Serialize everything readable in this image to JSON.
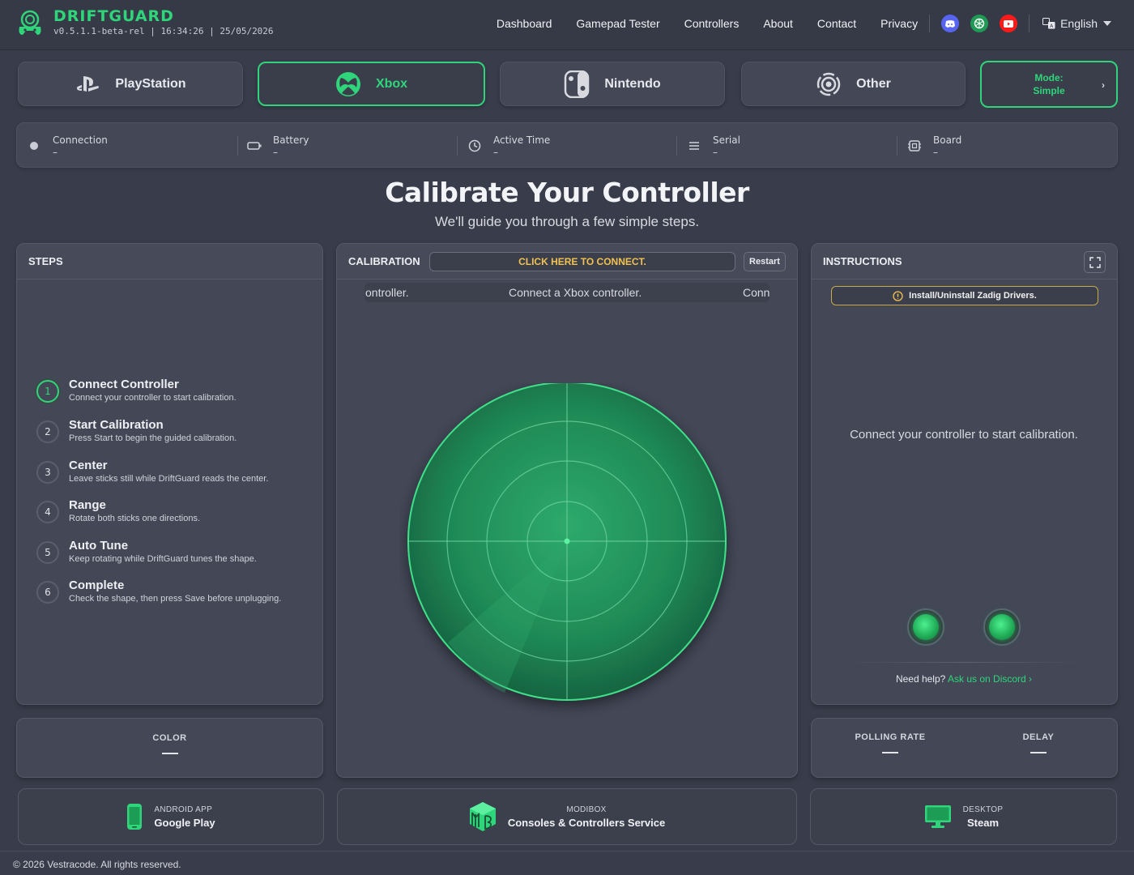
{
  "brand": {
    "name": "DRIFTGUARD",
    "version": "v0.5.1.1-beta-rel",
    "time": "16:34:26",
    "date": "25/05/2026",
    "sep": "|"
  },
  "nav": {
    "items": [
      "Dashboard",
      "Gamepad Tester",
      "Controllers",
      "About",
      "Contact",
      "Privacy"
    ],
    "language": "English",
    "social": [
      "discord-icon",
      "openai-icon",
      "youtube-icon"
    ]
  },
  "platforms": [
    {
      "label": "PlayStation",
      "active": false
    },
    {
      "label": "Xbox",
      "active": true
    },
    {
      "label": "Nintendo",
      "active": false
    },
    {
      "label": "Other",
      "active": false
    }
  ],
  "mode": {
    "label": "Mode:",
    "value": "Simple"
  },
  "status": [
    {
      "label": "Connection",
      "value": "–"
    },
    {
      "label": "Battery",
      "value": "–"
    },
    {
      "label": "Active Time",
      "value": "–"
    },
    {
      "label": "Serial",
      "value": "–"
    },
    {
      "label": "Board",
      "value": "–"
    }
  ],
  "hero": {
    "title": "Calibrate Your Controller",
    "subtitle": "We'll guide you through a few simple steps."
  },
  "steps": {
    "header": "STEPS",
    "items": [
      {
        "num": "1",
        "title": "Connect Controller",
        "desc": "Connect your controller to start calibration.",
        "active": true
      },
      {
        "num": "2",
        "title": "Start Calibration",
        "desc": "Press Start to begin the guided calibration."
      },
      {
        "num": "3",
        "title": "Center",
        "desc": "Leave sticks still while DriftGuard reads the center."
      },
      {
        "num": "4",
        "title": "Range",
        "desc": "Rotate both sticks one directions."
      },
      {
        "num": "5",
        "title": "Auto Tune",
        "desc": "Keep rotating while DriftGuard tunes the shape."
      },
      {
        "num": "6",
        "title": "Complete",
        "desc": "Check the shape, then press Save before unplugging."
      }
    ]
  },
  "calibration": {
    "header": "CALIBRATION",
    "connect": "CLICK HERE TO CONNECT.",
    "restart": "Restart",
    "ticker": [
      "ontroller.",
      "Connect a Xbox controller.",
      "Conn"
    ]
  },
  "instructions": {
    "header": "INSTRUCTIONS",
    "zadig": "Install/Uninstall Zadig Drivers.",
    "message": "Connect your controller to start calibration.",
    "help_prefix": "Need help?",
    "help_link": "Ask us on Discord ›"
  },
  "color": {
    "label": "COLOR"
  },
  "metrics": {
    "polling": "POLLING RATE",
    "delay": "DELAY"
  },
  "footer_cards": [
    {
      "small": "ANDROID APP",
      "big": "Google Play"
    },
    {
      "small": "MODIBOX",
      "big": "Consoles & Controllers Service"
    },
    {
      "small": "DESKTOP",
      "big": "Steam"
    }
  ],
  "copyright": "© 2026 Vestracode. All rights reserved.",
  "colors": {
    "accent": "#2fd57a",
    "warning": "#f2c14e",
    "bg": "#393d4b",
    "panel": "#434756"
  }
}
